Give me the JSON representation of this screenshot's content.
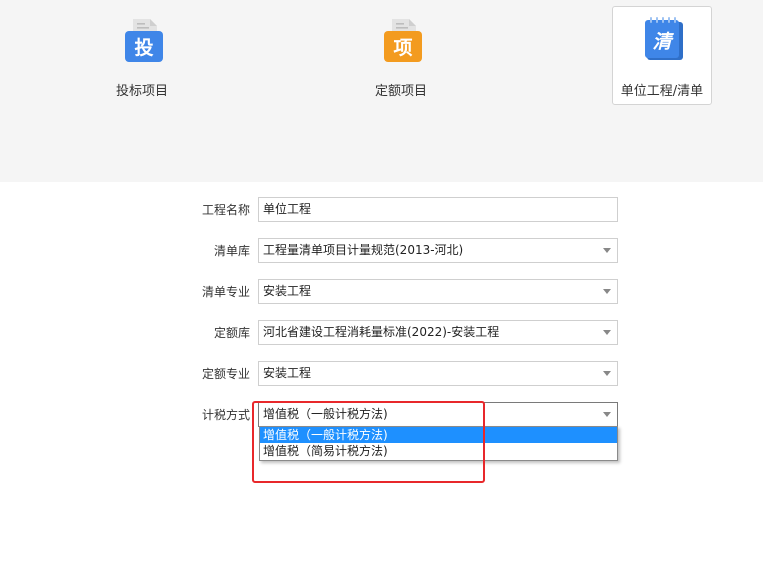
{
  "project_types": [
    {
      "label": "投标项目",
      "icon_char": "投",
      "icon": "bid-document-icon",
      "color": "#3f86e8"
    },
    {
      "label": "定额项目",
      "icon_char": "项",
      "icon": "quota-document-icon",
      "color": "#f39b1f"
    },
    {
      "label": "单位工程/清单",
      "icon_char": "清",
      "icon": "bill-notebook-icon",
      "color": "#3f86e8"
    }
  ],
  "selected_type": "单位工程/清单",
  "form": {
    "project_name": {
      "label": "工程名称",
      "value": "单位工程"
    },
    "bill_library": {
      "label": "清单库",
      "value": "工程量清单项目计量规范(2013-河北)"
    },
    "bill_specialty": {
      "label": "清单专业",
      "value": "安装工程"
    },
    "quota_library": {
      "label": "定额库",
      "value": "河北省建设工程消耗量标准(2022)-安装工程"
    },
    "quota_specialty": {
      "label": "定额专业",
      "value": "安装工程"
    },
    "tax_method": {
      "label": "计税方式",
      "value": "增值税（一般计税方法)",
      "options": [
        "增值税（一般计税方法)",
        "增值税（简易计税方法)"
      ]
    }
  },
  "colors": {
    "highlight": "#1e90ff",
    "annotation": "#e8282b"
  }
}
